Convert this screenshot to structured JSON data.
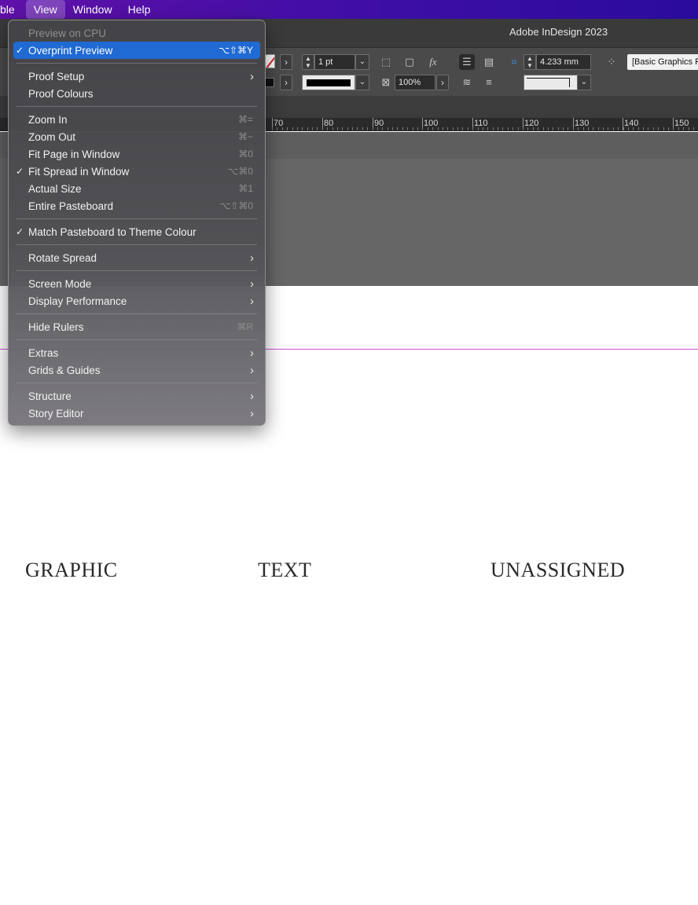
{
  "menubar": {
    "items": [
      "ble",
      "View",
      "Window",
      "Help"
    ],
    "active": "View"
  },
  "window": {
    "title": "Adobe InDesign 2023"
  },
  "control_panel": {
    "stroke_weight": "1 pt",
    "opacity": "100%",
    "dimension": "4.233 mm",
    "object_style": "[Basic Graphics F"
  },
  "ruler": {
    "labels": [
      "70",
      "80",
      "90",
      "100",
      "110",
      "120",
      "130",
      "140",
      "150"
    ]
  },
  "canvas": {
    "frame_labels": [
      "GRAPHIC",
      "TEXT",
      "UNASSIGNED"
    ],
    "guide_color": "#d04fd4"
  },
  "view_menu": {
    "items": [
      {
        "label": "Preview on CPU",
        "disabled": true
      },
      {
        "label": "Overprint Preview",
        "checked": true,
        "highlighted": true,
        "shortcut": "⌥⇧⌘Y"
      },
      {
        "label": "Proof Setup",
        "submenu": true
      },
      {
        "label": "Proof Colours"
      },
      {
        "label": "Zoom In",
        "shortcut": "⌘="
      },
      {
        "label": "Zoom Out",
        "shortcut": "⌘−"
      },
      {
        "label": "Fit Page in Window",
        "shortcut": "⌘0"
      },
      {
        "label": "Fit Spread in Window",
        "checked": true,
        "shortcut": "⌥⌘0"
      },
      {
        "label": "Actual Size",
        "shortcut": "⌘1"
      },
      {
        "label": "Entire Pasteboard",
        "shortcut": "⌥⇧⌘0"
      },
      {
        "label": "Match Pasteboard to Theme Colour",
        "checked": true
      },
      {
        "label": "Rotate Spread",
        "submenu": true
      },
      {
        "label": "Screen Mode",
        "submenu": true
      },
      {
        "label": "Display Performance",
        "submenu": true
      },
      {
        "label": "Hide Rulers",
        "shortcut": "⌘R"
      },
      {
        "label": "Extras",
        "submenu": true
      },
      {
        "label": "Grids & Guides",
        "submenu": true
      },
      {
        "label": "Structure",
        "submenu": true
      },
      {
        "label": "Story Editor",
        "submenu": true
      }
    ]
  },
  "icons": {
    "check": "checkmark-icon",
    "submenu": "chevron-right-icon",
    "dropdown": "chevron-down-icon"
  },
  "colors": {
    "highlight": "#1f6ad3",
    "menubar_start": "#5f10a8",
    "menubar_end": "#2a0b9c"
  }
}
